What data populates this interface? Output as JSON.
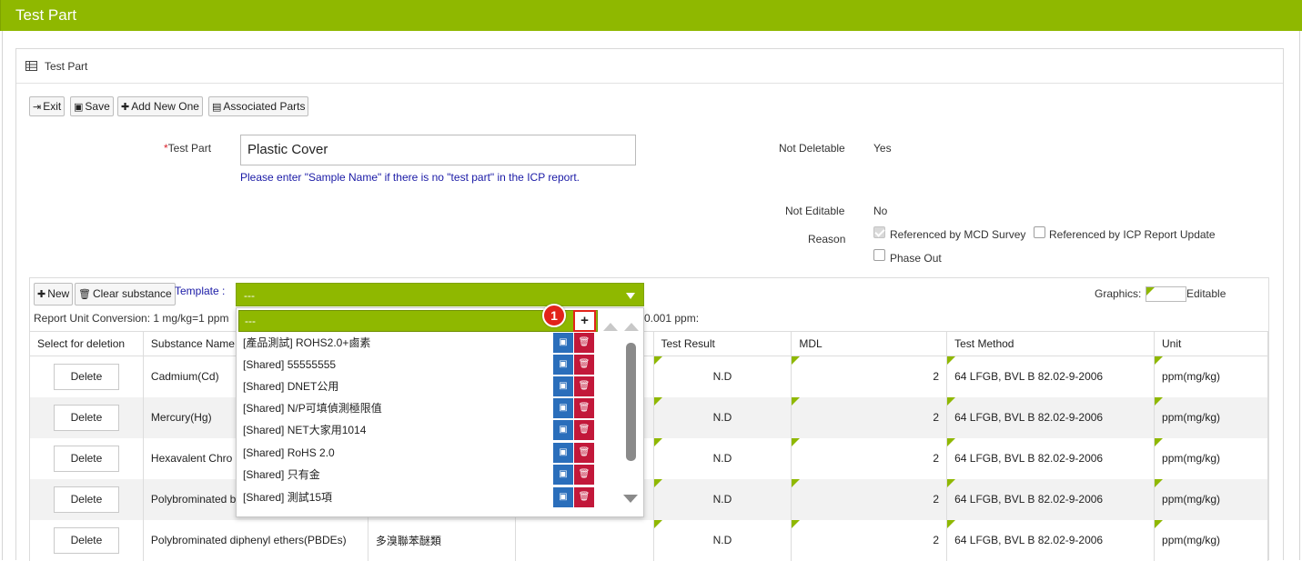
{
  "window": {
    "title": "Test Part"
  },
  "panel": {
    "title": "Test Part",
    "icon": "table-icon"
  },
  "toolbar": {
    "exit": "Exit",
    "save": "Save",
    "add_new": "Add New One",
    "associated": "Associated Parts"
  },
  "form": {
    "test_part_label": "Test Part",
    "required_mark": "*",
    "test_part_value": "Plastic Cover",
    "hint": "Please enter \"Sample Name\" if there is no \"test part\" in the ICP report.",
    "not_deletable_label": "Not Deletable",
    "not_deletable_value": "Yes",
    "not_editable_label": "Not Editable",
    "not_editable_value": "No",
    "reason_label": "Reason",
    "reasons": [
      {
        "label": "Referenced by MCD Survey",
        "checked": true
      },
      {
        "label": "Referenced by ICP Report Update",
        "checked": false
      },
      {
        "label": "Phase Out",
        "checked": false
      }
    ]
  },
  "substance": {
    "new_label": "New",
    "clear_label": "Clear substance",
    "template_label": "Template :",
    "template_value": "---",
    "graphics_label": "Graphics:",
    "editable_label": "Editable",
    "conversion_text": "Report Unit Conversion: 1 mg/kg=1 ppm",
    "conversion_tail": "0.001 ppm:"
  },
  "dropdown": {
    "search_value": "---",
    "badge": "1",
    "add_glyph": "+",
    "items": [
      "[產品測試] ROHS2.0+鹵素",
      "[Shared] 55555555",
      "[Shared] DNET公用",
      "[Shared] N/P可填偵測極限值",
      "[Shared] NET大家用1014",
      "[Shared] RoHS 2.0",
      "[Shared] 只有金",
      "[Shared] 測試15項"
    ]
  },
  "table": {
    "headers": [
      "Select for deletion",
      "Substance Name",
      "",
      "",
      "Test Result",
      "MDL",
      "Test Method",
      "Unit"
    ],
    "delete_label": "Delete",
    "rows": [
      {
        "name": "Cadmium(Cd)",
        "alias": "",
        "result": "N.D",
        "mdl": "2",
        "method": "64 LFGB, BVL B 82.02-9-2006",
        "unit": "ppm(mg/kg)"
      },
      {
        "name": "Mercury(Hg)",
        "alias": "",
        "result": "N.D",
        "mdl": "2",
        "method": "64 LFGB, BVL B 82.02-9-2006",
        "unit": "ppm(mg/kg)"
      },
      {
        "name": "Hexavalent Chro",
        "alias": "",
        "result": "N.D",
        "mdl": "2",
        "method": "64 LFGB, BVL B 82.02-9-2006",
        "unit": "ppm(mg/kg)"
      },
      {
        "name": "Polybrominated b",
        "alias": "",
        "result": "N.D",
        "mdl": "2",
        "method": "64 LFGB, BVL B 82.02-9-2006",
        "unit": "ppm(mg/kg)"
      },
      {
        "name": "Polybrominated diphenyl ethers(PBDEs)",
        "alias": "多溴聯苯醚類",
        "result": "N.D",
        "mdl": "2",
        "method": "64 LFGB, BVL B 82.02-9-2006",
        "unit": "ppm(mg/kg)"
      }
    ]
  },
  "colors": {
    "accent": "#8fb800",
    "save_icon_bg": "#2a6ebb",
    "delete_icon_bg": "#c2183a",
    "highlight": "#e2231a"
  }
}
